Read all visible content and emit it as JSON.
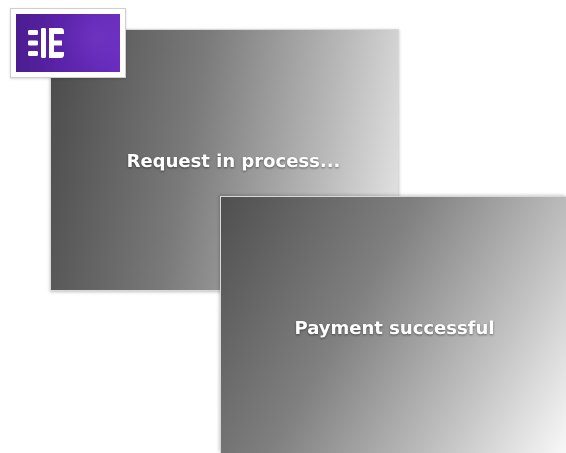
{
  "screens": {
    "processing": {
      "message": "Request in process..."
    },
    "success": {
      "message": "Payment successful"
    }
  },
  "logo": {
    "icon": "chip-card-icon",
    "color": "#5a22a8"
  }
}
